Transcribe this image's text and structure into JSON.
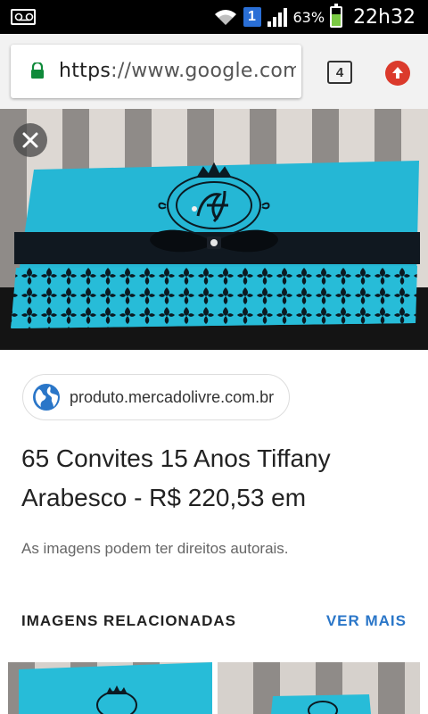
{
  "status_bar": {
    "sim_number": "1",
    "battery_percent": "63%",
    "time": "22h32"
  },
  "browser": {
    "url_scheme": "https",
    "url_rest": "://www.google.com.br",
    "tab_count": "4"
  },
  "result": {
    "source_domain": "produto.mercadolivre.com.br",
    "title": "65 Convites 15 Anos Tiffany Arabesco - R$ 220,53 em",
    "copyright_note": "As imagens podem ter direitos autorais."
  },
  "related": {
    "heading": "IMAGENS RELACIONADAS",
    "see_more": "VER MAIS"
  },
  "colors": {
    "tiffany": "#2bb8d6",
    "link_blue": "#2a76c8",
    "update_red": "#db3a2c"
  }
}
